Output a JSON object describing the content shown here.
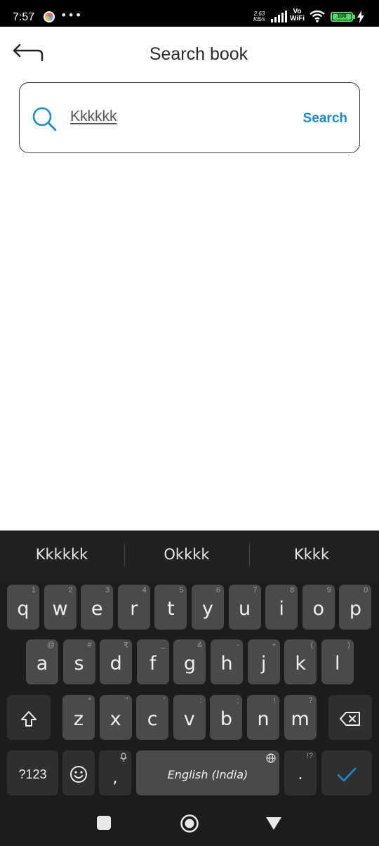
{
  "status_bar": {
    "time": "7:57",
    "speed_value": "2.63",
    "speed_unit": "KB/s",
    "vowifi_top": "Vo",
    "vowifi_bottom": "WiFi",
    "battery": "100"
  },
  "header": {
    "title": "Search book",
    "back_icon": "back-arrow-icon"
  },
  "search": {
    "query": "Kkkkkk",
    "action_label": "Search",
    "icon": "search-icon",
    "accent_color": "#1a8bd0"
  },
  "keyboard": {
    "suggestions": [
      "Kkkkkk",
      "Okkkk",
      "Kkkk"
    ],
    "row1": [
      {
        "key": "q",
        "hint": "1"
      },
      {
        "key": "w",
        "hint": "2"
      },
      {
        "key": "e",
        "hint": "3"
      },
      {
        "key": "r",
        "hint": "4"
      },
      {
        "key": "t",
        "hint": "5"
      },
      {
        "key": "y",
        "hint": "6"
      },
      {
        "key": "u",
        "hint": "7"
      },
      {
        "key": "i",
        "hint": "8"
      },
      {
        "key": "o",
        "hint": "9"
      },
      {
        "key": "p",
        "hint": "0"
      }
    ],
    "row2": [
      {
        "key": "a",
        "hint": "@"
      },
      {
        "key": "s",
        "hint": "#"
      },
      {
        "key": "d",
        "hint": "₹"
      },
      {
        "key": "f",
        "hint": "_"
      },
      {
        "key": "g",
        "hint": "&"
      },
      {
        "key": "h",
        "hint": "-"
      },
      {
        "key": "j",
        "hint": "+"
      },
      {
        "key": "k",
        "hint": "("
      },
      {
        "key": "l",
        "hint": ")"
      }
    ],
    "row3": [
      {
        "key": "z",
        "hint": "*"
      },
      {
        "key": "x",
        "hint": "\""
      },
      {
        "key": "c",
        "hint": "'"
      },
      {
        "key": "v",
        "hint": ":"
      },
      {
        "key": "b",
        "hint": ";"
      },
      {
        "key": "n",
        "hint": "!"
      },
      {
        "key": "m",
        "hint": "?"
      }
    ],
    "shift_icon": "shift-icon",
    "backspace_icon": "backspace-icon",
    "symbols_label": "?123",
    "emoji_icon": "emoji-icon",
    "comma_label": ",",
    "mic_icon": "microphone-icon",
    "space_label": "English (India)",
    "globe_icon": "globe-icon",
    "period_label": ".",
    "period_hint": "!?",
    "enter_icon": "checkmark-icon",
    "enter_color": "#1a8bd0"
  },
  "nav": {
    "recents_icon": "recents-square-icon",
    "home_icon": "home-circle-icon",
    "back_icon": "back-triangle-icon"
  }
}
